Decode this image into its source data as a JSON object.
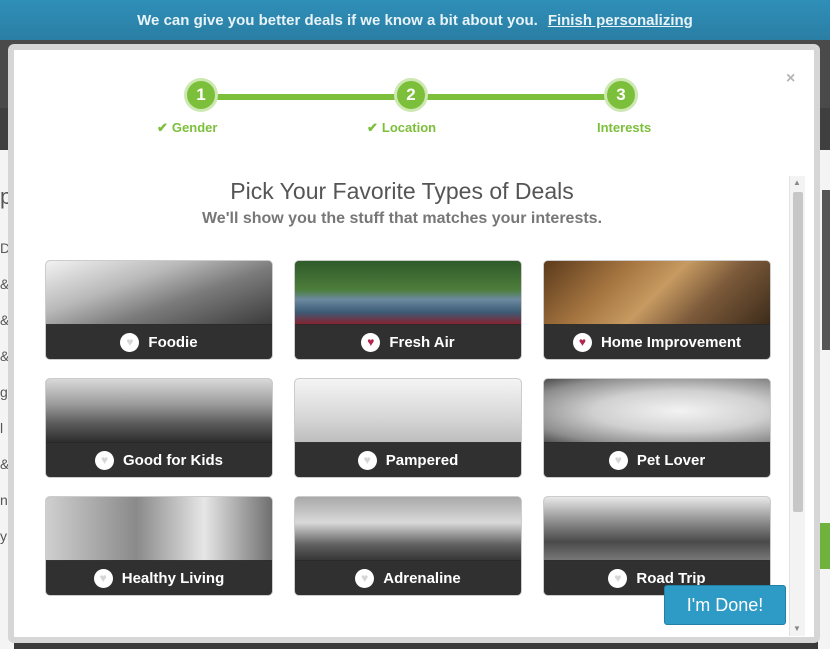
{
  "banner": {
    "message": "We can give you better deals if we know a bit about you.",
    "link": "Finish personalizing"
  },
  "background": {
    "left_letters": [
      "p",
      "D",
      "&",
      "&",
      "&",
      "g",
      "l",
      "&",
      "ni",
      "y"
    ]
  },
  "modal": {
    "close": "×",
    "steps": [
      {
        "number": "1",
        "label": "Gender",
        "completed": true
      },
      {
        "number": "2",
        "label": "Location",
        "completed": true
      },
      {
        "number": "3",
        "label": "Interests",
        "completed": false
      }
    ],
    "check_glyph": "✔",
    "title": "Pick Your Favorite Types of Deals",
    "subtitle": "We'll show you the stuff that matches your interests.",
    "heart_glyph": "♥",
    "tiles": [
      {
        "label": "Foodie",
        "selected": false
      },
      {
        "label": "Fresh Air",
        "selected": true
      },
      {
        "label": "Home Improvement",
        "selected": true
      },
      {
        "label": "Good for Kids",
        "selected": false
      },
      {
        "label": "Pampered",
        "selected": false
      },
      {
        "label": "Pet Lover",
        "selected": false
      },
      {
        "label": "Healthy Living",
        "selected": false
      },
      {
        "label": "Adrenaline",
        "selected": false
      },
      {
        "label": "Road Trip",
        "selected": false
      }
    ],
    "done_button": "I'm Done!"
  },
  "colors": {
    "accent_green": "#7cbf3a",
    "heart_selected": "#b1254e",
    "button_blue": "#2e9ac6",
    "banner_blue": "#2f8fb8"
  }
}
